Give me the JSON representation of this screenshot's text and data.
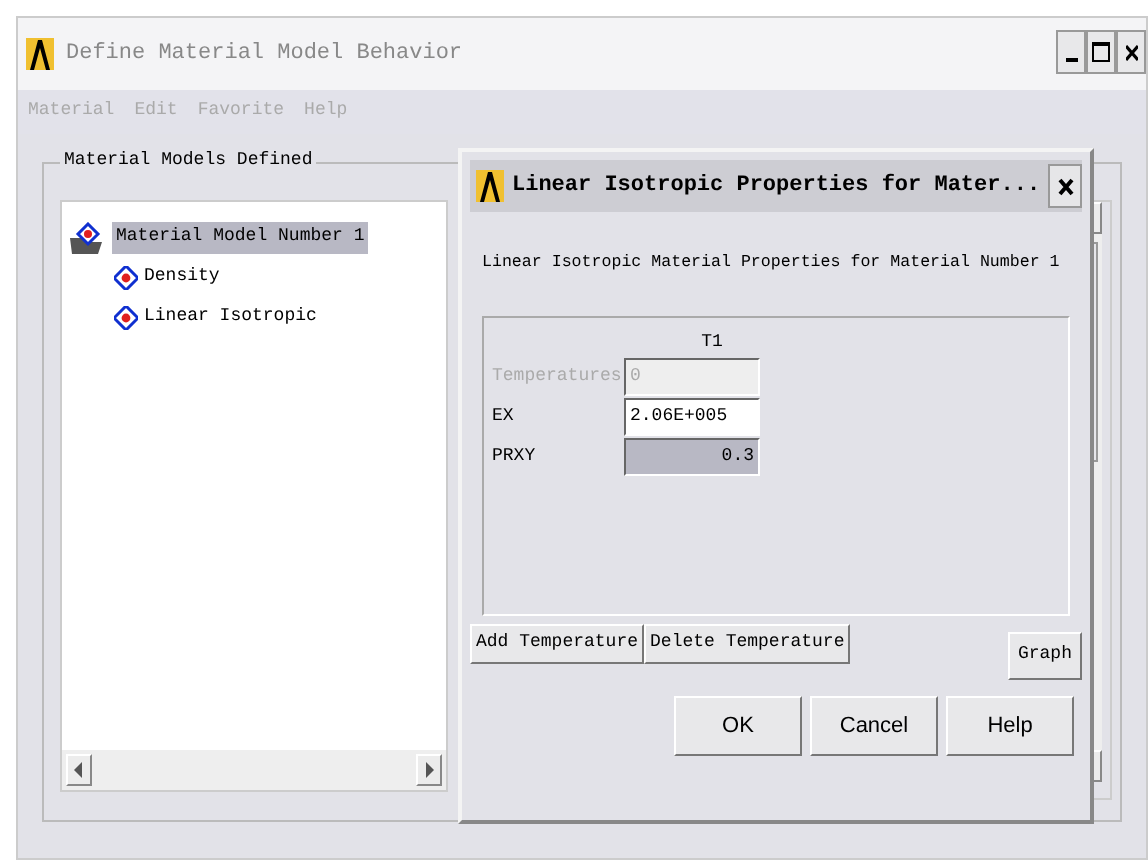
{
  "window": {
    "title": "Define Material Model Behavior"
  },
  "menu": [
    {
      "label": "Material",
      "disabled": true
    },
    {
      "label": "Edit",
      "disabled": true
    },
    {
      "label": "Favorite",
      "disabled": true
    },
    {
      "label": "Help",
      "disabled": true
    }
  ],
  "group": {
    "label": "Material Models Defined"
  },
  "tree": [
    {
      "label": "Material Model Number 1",
      "kind": "folder",
      "selected": true,
      "children": [
        {
          "label": "Density",
          "kind": "model",
          "selected": false
        },
        {
          "label": "Linear Isotropic",
          "kind": "model",
          "selected": false
        }
      ]
    }
  ],
  "dialog": {
    "title": "Linear Isotropic Properties for Mater...",
    "subtitle": "Linear Isotropic Material Properties for Material Number 1",
    "column": "T1",
    "rows": [
      {
        "label": "Temperatures",
        "value": "0",
        "disabled": true,
        "selected": false
      },
      {
        "label": "EX",
        "value": "2.06E+005",
        "disabled": false,
        "selected": false
      },
      {
        "label": "PRXY",
        "value": "0.3",
        "disabled": false,
        "selected": true
      }
    ],
    "table_buttons": [
      "Add Temperature",
      "Delete Temperature"
    ],
    "graph_button": "Graph",
    "buttons": [
      "OK",
      "Cancel",
      "Help"
    ]
  }
}
